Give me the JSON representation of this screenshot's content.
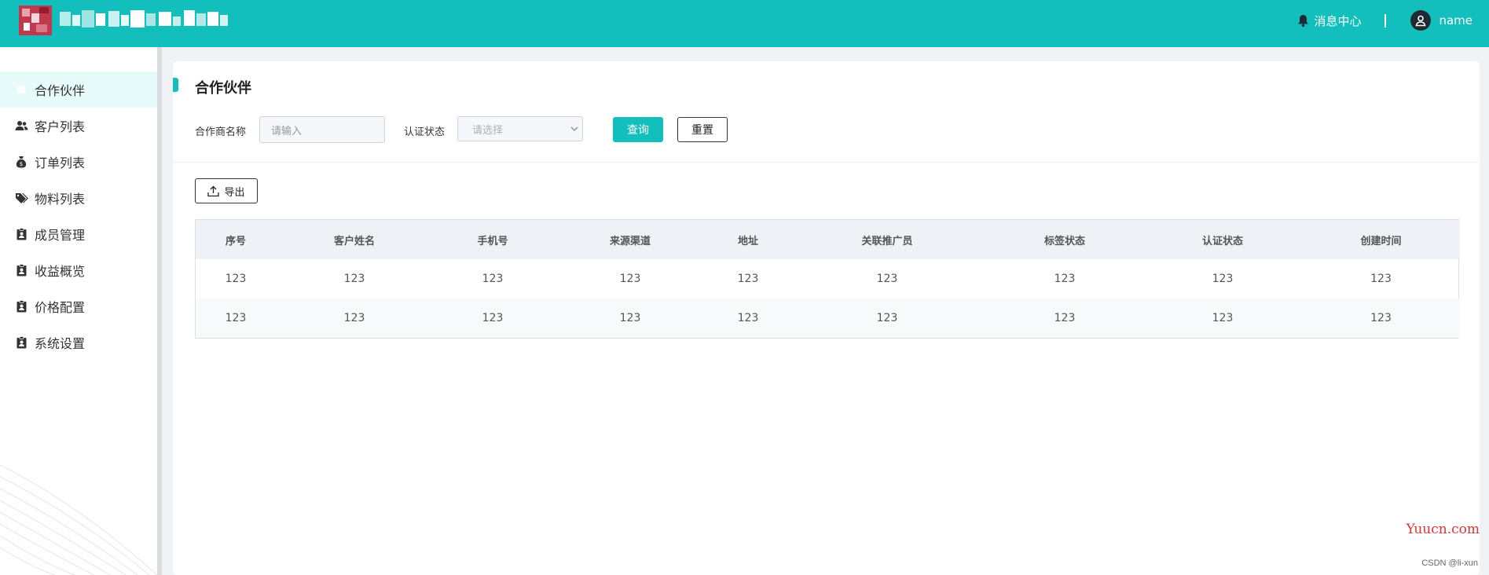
{
  "header": {
    "message_center": "消息中心",
    "user_name": "name"
  },
  "sidebar": {
    "items": [
      {
        "label": "合作伙伴",
        "icon": "partner-icon",
        "active": true
      },
      {
        "label": "客户列表",
        "icon": "users-icon"
      },
      {
        "label": "订单列表",
        "icon": "money-bag-icon"
      },
      {
        "label": "物料列表",
        "icon": "tags-icon"
      },
      {
        "label": "成员管理",
        "icon": "clipboard-user-icon"
      },
      {
        "label": "收益概览",
        "icon": "clipboard-user-icon"
      },
      {
        "label": "价格配置",
        "icon": "clipboard-user-icon"
      },
      {
        "label": "系统设置",
        "icon": "clipboard-user-icon"
      }
    ]
  },
  "main": {
    "title": "合作伙伴",
    "filters": {
      "partner_name_label": "合作商名称",
      "partner_name_placeholder": "请输入",
      "status_label": "认证状态",
      "status_placeholder": "请选择",
      "query_label": "查询",
      "reset_label": "重置"
    },
    "export_label": "导出",
    "table": {
      "columns": [
        "序号",
        "客户姓名",
        "手机号",
        "来源渠道",
        "地址",
        "关联推广员",
        "标签状态",
        "认证状态",
        "创建时间"
      ],
      "rows": [
        [
          "123",
          "123",
          "123",
          "123",
          "123",
          "123",
          "123",
          "123",
          "123"
        ],
        [
          "123",
          "123",
          "123",
          "123",
          "123",
          "123",
          "123",
          "123",
          "123"
        ]
      ]
    }
  },
  "watermark": "Yuucn.com",
  "csdn_credit": "CSDN @li-xun",
  "colors": {
    "accent": "#12bfbd",
    "active_bg": "#e6fbfa",
    "table_header_bg": "#eef1f5"
  }
}
